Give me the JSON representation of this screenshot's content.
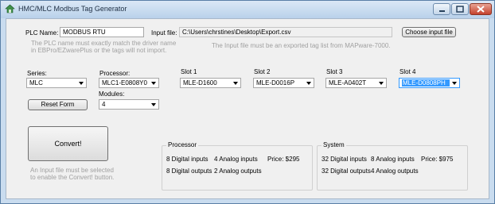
{
  "window": {
    "title": "HMC/MLC Modbus Tag Generator"
  },
  "plc": {
    "label": "PLC Name:",
    "value": "MODBUS RTU",
    "hint1": "The PLC name must exactly match the driver name",
    "hint2": "in EBPro/EZwarePlus or the tags will not import."
  },
  "input_file": {
    "label": "Input file:",
    "value": "C:\\Users\\chrstines\\Desktop\\Export.csv",
    "hint": "The Input file must be an exported tag list from MAPware-7000.",
    "button": "Choose input file"
  },
  "series": {
    "label": "Series:",
    "value": "MLC"
  },
  "processor": {
    "label": "Processor:",
    "value": "MLC1-E0808Y0402T"
  },
  "modules": {
    "label": "Modules:",
    "value": "4"
  },
  "slots": [
    {
      "label": "Slot 1",
      "value": "MLE-D1600"
    },
    {
      "label": "Slot 2",
      "value": "MLE-D0016P"
    },
    {
      "label": "Slot 3",
      "value": "MLE-A0402T"
    },
    {
      "label": "Slot 4",
      "value": "MLE-D0808PH"
    }
  ],
  "reset_button": "Reset Form",
  "convert": {
    "button": "Convert!",
    "hint1": "An Input file must be selected",
    "hint2": "to enable the Convert! button."
  },
  "processor_summary": {
    "title": "Processor",
    "digital_inputs": "8 Digital inputs",
    "digital_outputs": "8 Digital outputs",
    "analog_inputs": "4 Analog inputs",
    "analog_outputs": "2 Analog outputs",
    "price": "Price: $295"
  },
  "system_summary": {
    "title": "System",
    "digital_inputs": "32 Digital inputs",
    "digital_outputs": "32 Digital outputs",
    "analog_inputs": "8 Analog inputs",
    "analog_outputs": "4 Analog outputs",
    "price": "Price: $975"
  },
  "colors": {
    "titlebar": "#c9dcef",
    "selection": "#3399ff",
    "hint": "#a0a0a0"
  }
}
